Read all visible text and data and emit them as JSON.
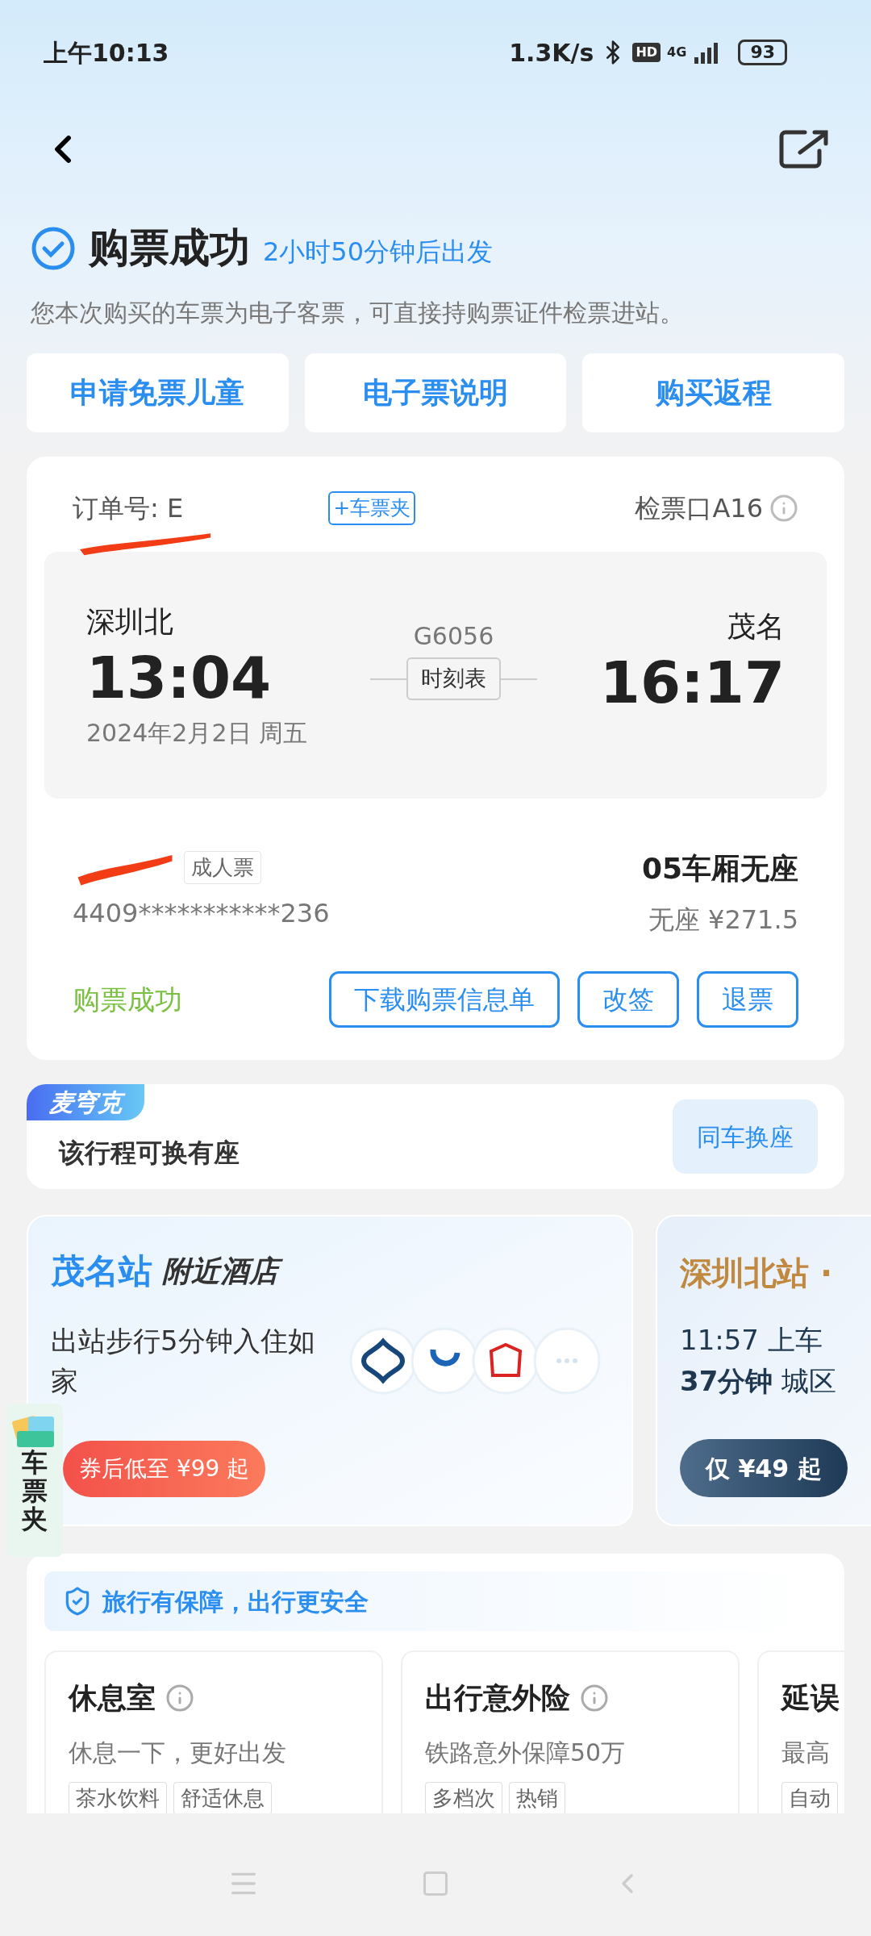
{
  "status_bar": {
    "time": "上午10:13",
    "speed": "1.3K/s",
    "hd": "HD",
    "network": "4G",
    "battery": "93"
  },
  "header": {
    "title": "购票成功",
    "countdown": "2小时50分钟后出发",
    "notice": "您本次购买的车票为电子客票，可直接持购票证件检票进站。"
  },
  "actions": [
    "申请免票儿童",
    "电子票说明",
    "购买返程"
  ],
  "order": {
    "label": "订单号: E",
    "redacted": true,
    "wallet": "+车票夹",
    "gate": "检票口A16",
    "from": {
      "station": "深圳北",
      "time": "13:04"
    },
    "train": "G6056",
    "timetable": "时刻表",
    "to": {
      "station": "茂名",
      "time": "16:17"
    },
    "date": "2024年2月2日 周五",
    "passenger": {
      "name_redacted": true,
      "type": "成人票",
      "id": "4409***********236",
      "seat": "05车厢无座",
      "price": "无座 ¥271.5"
    },
    "status": "购票成功",
    "buttons": [
      "下载购票信息单",
      "改签",
      "退票"
    ]
  },
  "seat_swap": {
    "badge": "麦穹克",
    "text": "该行程可换有座",
    "button": "同车换座"
  },
  "hotel": {
    "station": "茂名站",
    "label": "附近酒店",
    "desc": "出站步行5分钟入住如家",
    "price": "券后低至 ¥99 起"
  },
  "transfer": {
    "station": "深圳北站 ·",
    "line1": "11:57 上车",
    "line2_bold": "37分钟",
    "line2": "城区",
    "price": "仅 ¥49 起"
  },
  "wallet_float": "车票夹",
  "insurance": {
    "title": "旅行有保障，出行更安全",
    "items": [
      {
        "title": "休息室",
        "info": true,
        "desc": "休息一下，更好出发",
        "tags": [
          "茶水饮料",
          "舒适休息"
        ]
      },
      {
        "title": "出行意外险",
        "info": true,
        "desc": "铁路意外保障50万",
        "tags": [
          "多档次",
          "热销"
        ]
      },
      {
        "title": "延误",
        "info": false,
        "desc": "最高",
        "tags": [
          "自动"
        ]
      }
    ]
  }
}
